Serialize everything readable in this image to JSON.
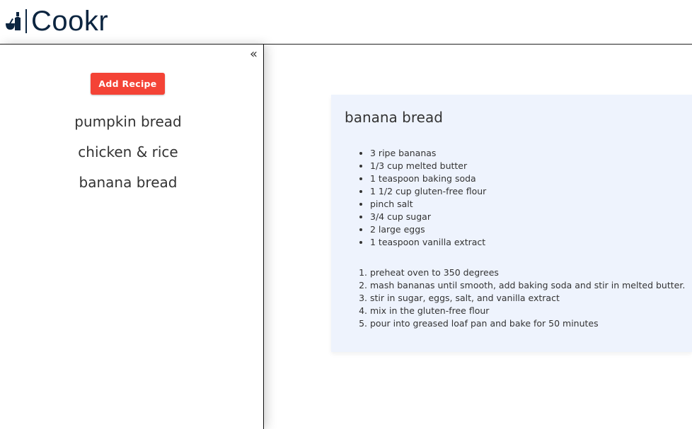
{
  "brand": {
    "name": "Cookr",
    "logo_icon": "bottle-and-bowl-icon",
    "color": "#0c2540"
  },
  "sidebar": {
    "collapse_label": "«",
    "add_button_label": "Add Recipe",
    "recipes": [
      "pumpkin bread",
      "chicken & rice",
      "banana bread"
    ]
  },
  "recipe": {
    "title": "banana bread",
    "ingredients": [
      "3 ripe bananas",
      "1/3 cup melted butter",
      "1 teaspoon baking soda",
      "1 1/2 cup gluten-free flour",
      "pinch salt",
      "3/4 cup sugar",
      "2 large eggs",
      "1 teaspoon vanilla extract"
    ],
    "directions": [
      "preheat oven to 350 degrees",
      "mash bananas until smooth, add baking soda and stir in melted butter.",
      "stir in sugar, eggs, salt, and vanilla extract",
      "mix in the gluten-free flour",
      "pour into greased loaf pan and bake for 50 minutes"
    ]
  },
  "colors": {
    "accent": "#f44336",
    "card_bg": "#eef3fd"
  }
}
